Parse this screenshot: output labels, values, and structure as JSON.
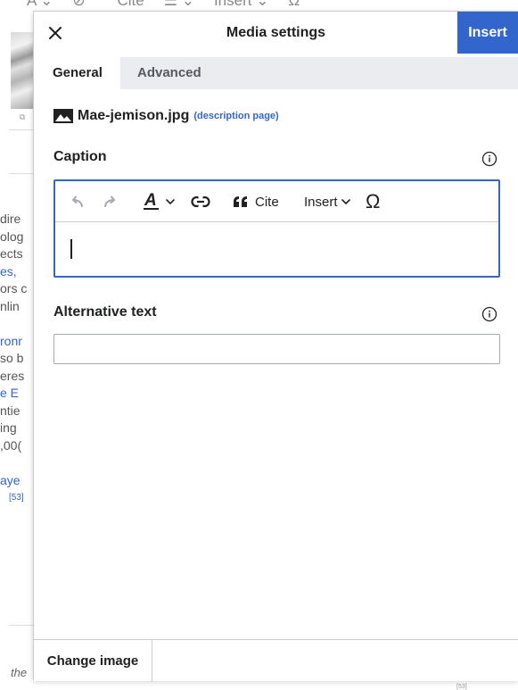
{
  "background": {
    "toolbar_items": [
      "A ⌄",
      "⊘",
      "❝ Cite",
      "☰ ⌄",
      "Insert ⌄",
      "Ω"
    ],
    "lines": [
      "dire",
      "olog",
      "ects",
      "es,",
      "ors c",
      "nlin",
      "",
      "ronr",
      "so b",
      "eres",
      "e E",
      "ntie",
      "ing",
      ",00(",
      "",
      "aye",
      "[53]"
    ],
    "footer_text": "the",
    "footer_sup": "[53]"
  },
  "dialog": {
    "title": "Media settings",
    "insert_label": "Insert",
    "tabs": [
      {
        "label": "General",
        "active": true
      },
      {
        "label": "Advanced",
        "active": false
      }
    ],
    "file": {
      "name": "Mae-jemison.jpg",
      "description_link": "(description page)"
    },
    "caption": {
      "label": "Caption",
      "value": "",
      "toolbar": {
        "undo_icon": "undo-icon",
        "redo_icon": "redo-icon",
        "text_style_icon": "text-style-icon",
        "link_icon": "link-icon",
        "cite_label": "Cite",
        "insert_label": "Insert",
        "special_char_icon": "omega-icon"
      }
    },
    "alt_text": {
      "label": "Alternative text",
      "value": ""
    },
    "footer": {
      "change_image_label": "Change image"
    }
  },
  "colors": {
    "accent": "#3366cc",
    "border": "#c8ccd1",
    "tab_bar": "#eaecf0",
    "text": "#202122"
  }
}
